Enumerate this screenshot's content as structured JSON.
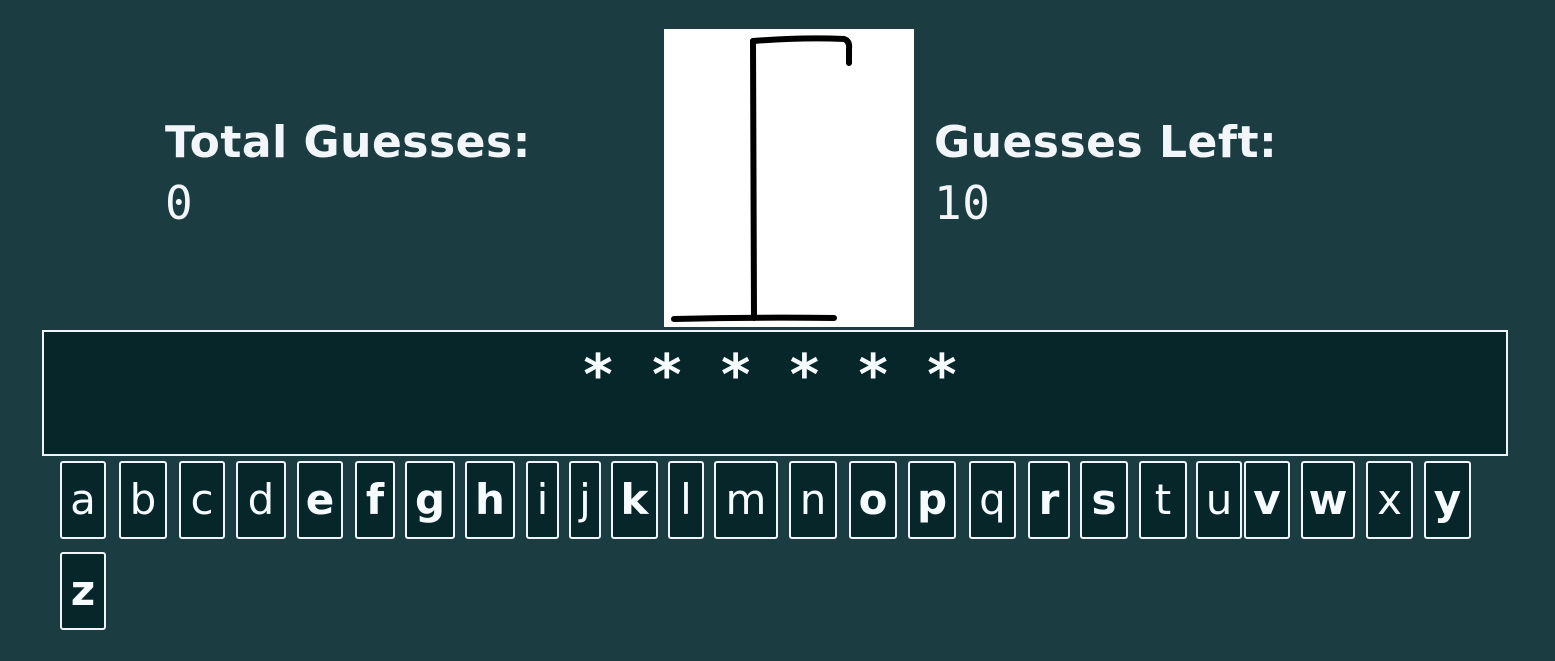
{
  "stats": {
    "total_guesses_label": "Total Guesses:",
    "total_guesses_value": "0",
    "guesses_left_label": "Guesses Left:",
    "guesses_left_value": "10"
  },
  "word": {
    "display": "* * * * * *"
  },
  "colors": {
    "background": "#1b3d41",
    "panel": "#062629",
    "text": "#f2f6fb"
  },
  "letters": [
    "a",
    "b",
    "c",
    "d",
    "e",
    "f",
    "g",
    "h",
    "i",
    "j",
    "k",
    "l",
    "m",
    "n",
    "o",
    "p",
    "q",
    "r",
    "s",
    "t",
    "u",
    "v",
    "w",
    "x",
    "y",
    "z"
  ],
  "bold_letters": [
    "e",
    "f",
    "g",
    "h",
    "k",
    "o",
    "p",
    "r",
    "s",
    "v",
    "w",
    "y",
    "z"
  ]
}
